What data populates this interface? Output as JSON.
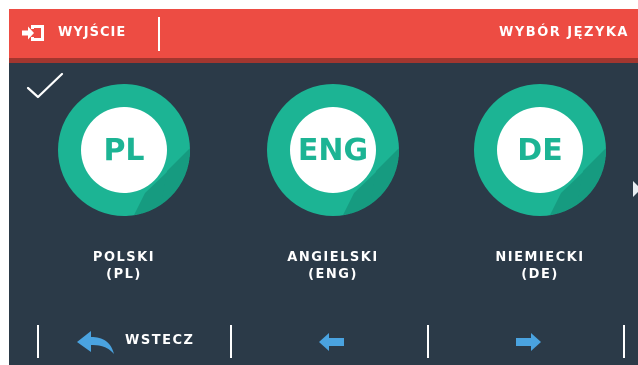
{
  "header": {
    "exit_label": "WYJŚCIE",
    "title": "WYBÓR JĘZYKA"
  },
  "languages": [
    {
      "code": "PL",
      "name": "POLSKI",
      "abbr": "(PL)",
      "selected": true
    },
    {
      "code": "ENG",
      "name": "ANGIELSKI",
      "abbr": "(ENG)",
      "selected": false
    },
    {
      "code": "DE",
      "name": "NIEMIECKI",
      "abbr": "(DE)",
      "selected": false
    }
  ],
  "footer": {
    "back_label": "WSTECZ"
  },
  "icons": {
    "exit": "exit-door-icon",
    "selected": "checkmark-icon",
    "back": "back-arrow-icon",
    "prev": "arrow-left-icon",
    "next": "arrow-right-icon",
    "more": "chevron-right-icon"
  },
  "colors": {
    "header": "#ed4c43",
    "background": "#2b3a48",
    "accent": "#1cb494",
    "icon_blue": "#4aa3e0"
  }
}
